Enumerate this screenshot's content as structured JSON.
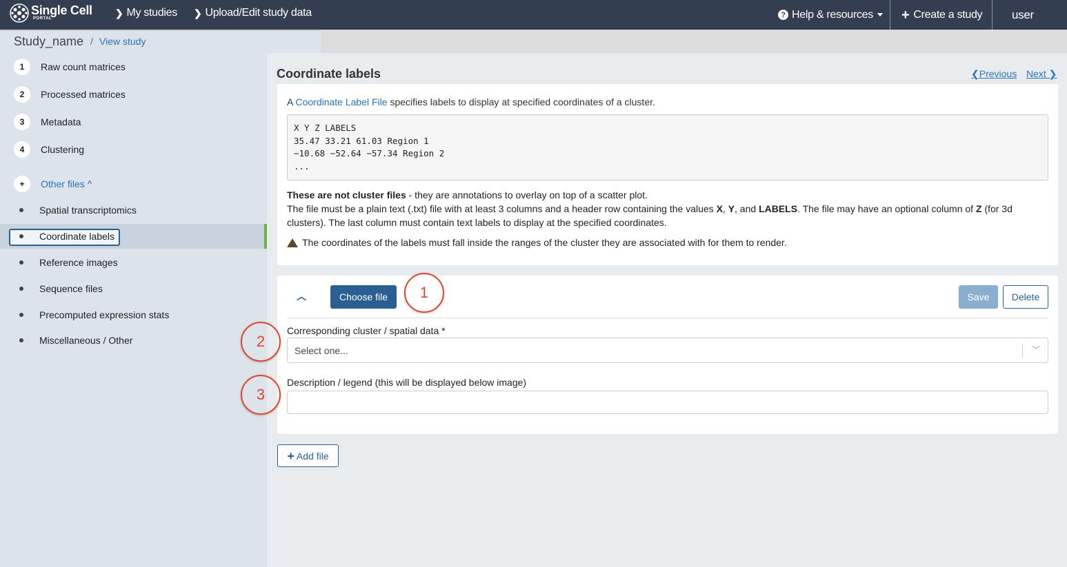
{
  "navbar": {
    "brand_main": "Single Cell",
    "brand_sub": "PORTAL",
    "my_studies": "My studies",
    "upload_edit": "Upload/Edit study data",
    "help": "Help & resources",
    "create": "Create a study",
    "user": "user"
  },
  "breadcrumb": {
    "study": "Study_name",
    "slash": "/",
    "view": "View study"
  },
  "sidebar": {
    "steps": [
      {
        "num": "1",
        "label": "Raw count matrices"
      },
      {
        "num": "2",
        "label": "Processed matrices"
      },
      {
        "num": "3",
        "label": "Metadata"
      },
      {
        "num": "4",
        "label": "Clustering"
      }
    ],
    "other": {
      "num": "+",
      "label": "Other files"
    },
    "sub_items": [
      "Spatial transcriptomics",
      "Coordinate labels",
      "Reference images",
      "Sequence files",
      "Precomputed expression stats",
      "Miscellaneous / Other"
    ]
  },
  "main": {
    "title": "Coordinate labels",
    "previous": "Previous",
    "next": "Next",
    "intro_a": "A",
    "intro_link": "Coordinate Label File",
    "intro_rest": "specifies labels to display at specified coordinates of a cluster.",
    "code_lines": "X Y Z LABELS\n35.47 33.21 61.03 Region 1\n−10.68 −52.64 −57.34 Region 2\n...",
    "not_cluster_bold": "These are not cluster files",
    "not_cluster_rest": " - they are annotations to overlay on top of a scatter plot.",
    "req_1": "The file must be a plain text (.txt) file with at least 3 columns and a header row containing the values ",
    "req_x": "X",
    "req_comma": ", ",
    "req_y": "Y",
    "req_and": ", and ",
    "req_labels": "LABELS",
    "req_2": ". The file may have an optional column of ",
    "req_z": "Z",
    "req_3": " (for 3d clusters). The last column must contain text labels to display at the specified coordinates.",
    "warning": "The coordinates of the labels must fall inside the ranges of the cluster they are associated with for them to render."
  },
  "form": {
    "choose_file": "Choose file",
    "save": "Save",
    "delete": "Delete",
    "cluster_label": "Corresponding cluster / spatial data *",
    "cluster_placeholder": "Select one...",
    "desc_label": "Description / legend (this will be displayed below image)",
    "desc_value": "",
    "add_file": "Add file"
  },
  "callouts": [
    "1",
    "2",
    "3"
  ],
  "colors": {
    "navbar": "#333f50",
    "primary": "#2a5f94",
    "link": "#2a73b8",
    "active_bar": "#6cb33f",
    "callout": "#e0442c"
  },
  "icons": [
    "logo-icon",
    "chevron-right-icon",
    "help-icon",
    "caret-down-icon",
    "plus-icon",
    "chevron-up-icon",
    "warning-icon",
    "chevron-down-icon"
  ]
}
